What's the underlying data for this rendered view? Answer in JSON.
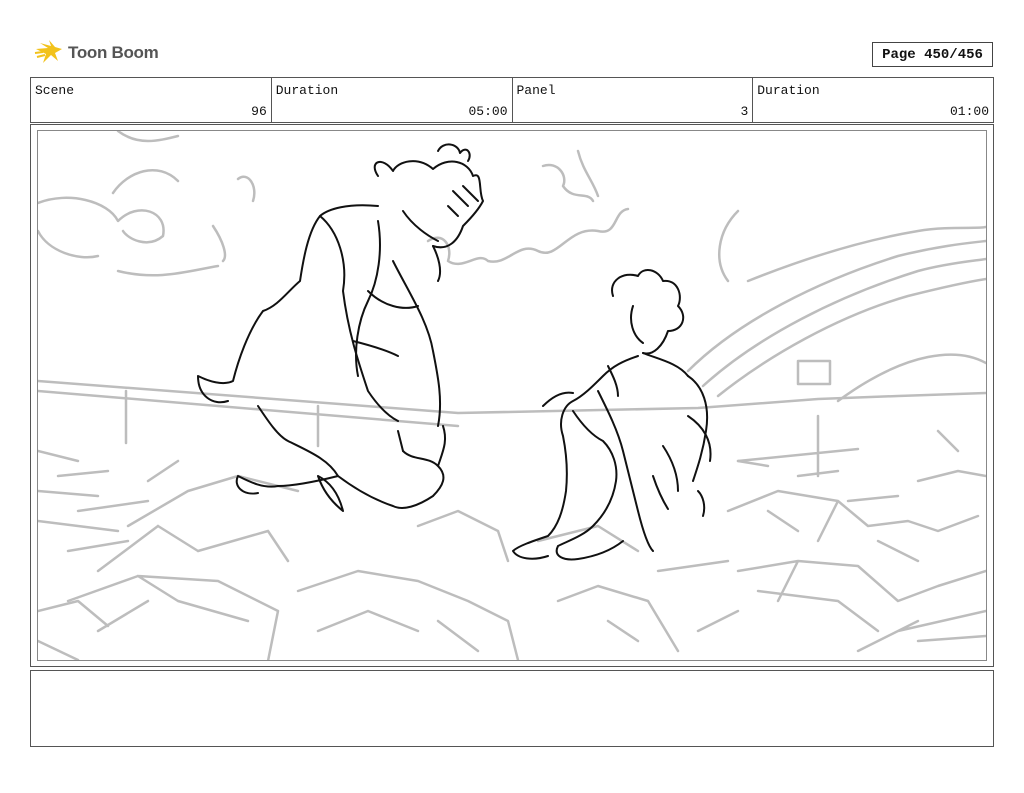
{
  "header": {
    "logo_text": "Toon Boom",
    "page_indicator": "Page 450/456"
  },
  "info": {
    "scene_label": "Scene",
    "scene_value": "96",
    "duration_label": "Duration",
    "duration_value": "05:00",
    "panel_label": "Panel",
    "panel_value": "3",
    "panel_duration_label": "Duration",
    "panel_duration_value": "01:00"
  },
  "panel": {
    "sketch_icon": "storyboard-sketch"
  },
  "notes": {
    "text": ""
  },
  "colors": {
    "logo_accent": "#f2c21b",
    "sketch_line": "#111111",
    "background_line": "#bdbdbd"
  }
}
